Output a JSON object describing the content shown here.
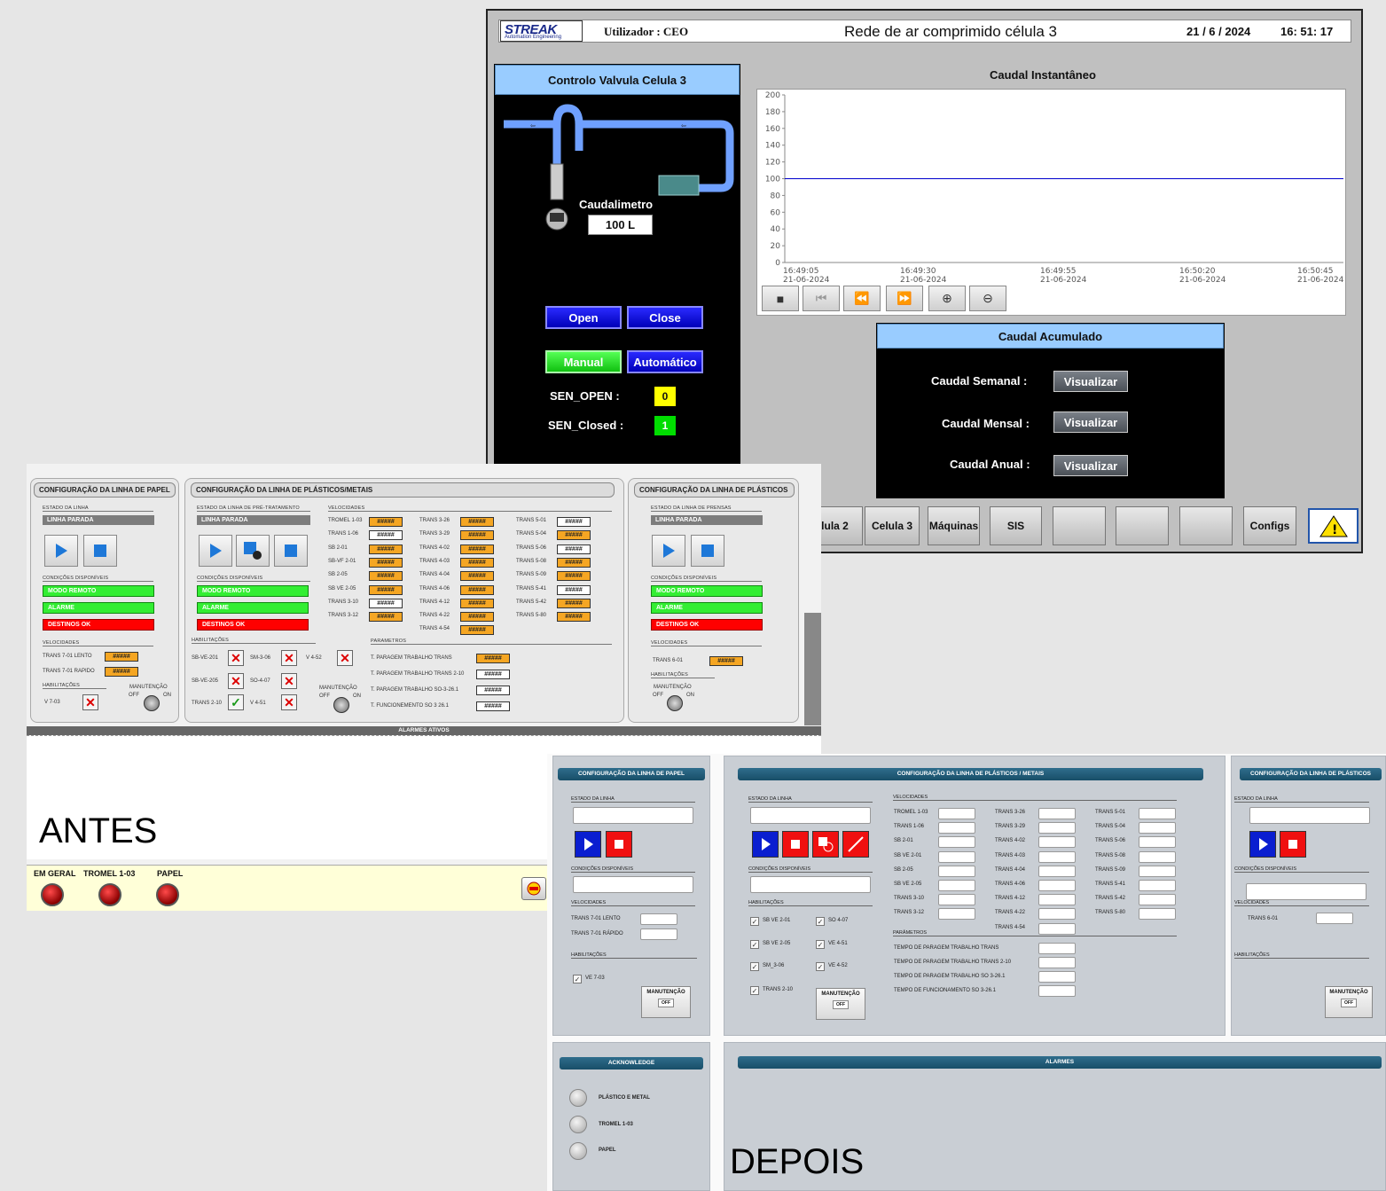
{
  "scada": {
    "logo_brand": "STREAK",
    "logo_sub": "Automation Engineering",
    "user_label": "Utilizador : CEO",
    "title": "Rede de ar comprimido célula 3",
    "date": "21 / 6 / 2024",
    "time": "16: 51: 17",
    "valve_panel_title": "Controlo Valvula Celula 3",
    "flowmeter_label": "Caudalimetro",
    "flowmeter_value": "100 L",
    "open_label": "Open",
    "close_label": "Close",
    "manual_label": "Manual",
    "auto_label": "Automático",
    "sen_open_label": "SEN_OPEN :",
    "sen_open_value": "0",
    "sen_closed_label": "SEN_Closed :",
    "sen_closed_value": "1",
    "chart_title": "Caudal Instantâneo",
    "accum_title": "Caudal Acumulado",
    "weekly_label": "Caudal Semanal :",
    "monthly_label": "Caudal Mensal :",
    "annual_label": "Caudal Anual :",
    "view_label": "Visualizar",
    "nav": [
      "lula 2",
      "Celula 3",
      "Máquinas",
      "SIS",
      "",
      "",
      "",
      "Configs"
    ],
    "colors": {
      "accent_blue": "#0000cc",
      "sen_open": "#ffff00",
      "sen_closed": "#00dd00",
      "panel_title_bg": "#99ccff"
    }
  },
  "chart_data": {
    "type": "line",
    "title": "Caudal Instantâneo",
    "x": [
      "16:49:05",
      "16:49:30",
      "16:49:55",
      "16:50:20",
      "16:50:45"
    ],
    "x_dates": [
      "21-06-2024",
      "21-06-2024",
      "21-06-2024",
      "21-06-2024",
      "21-06-2024"
    ],
    "series": [
      {
        "values": [
          100,
          100,
          100,
          100,
          100
        ]
      }
    ],
    "ylim": [
      0,
      200
    ],
    "yticks": [
      "200",
      "180",
      "160",
      "140",
      "120",
      "100",
      "80",
      "60",
      "40",
      "20",
      "0"
    ],
    "grid": false
  },
  "antes": {
    "label": "ANTES",
    "papel": {
      "title": "CONFIGURAÇÃO DA LINHA DE PAPEL",
      "estado": "ESTADO DA LINHA",
      "linha": "LINHA PARADA",
      "cond": "CONDIÇÕES DISPONÍVEIS",
      "modo": "MODO REMOTO",
      "alarme": "ALARME",
      "destinos": "DESTINOS OK",
      "vel": "VELOCIDADES",
      "v1": "TRANS 7-01 LENTO",
      "v2": "TRANS 7-01 RAPIDO",
      "hab": "HABILITAÇÕES",
      "h1": "V 7-03",
      "mant": "MANUTENÇÃO",
      "off": "OFF",
      "on": "ON",
      "hash": "#####"
    },
    "plast": {
      "title": "CONFIGURAÇÃO DA LINHA DE PLÁSTICOS/METAIS",
      "estado": "ESTADO DA LINHA DE PRÉ-TRATAMENTO",
      "linha": "LINHA PARADA",
      "cond": "CONDIÇÕES DISPONÍVEIS",
      "modo": "MODO REMOTO",
      "alarme": "ALARME",
      "destinos": "DESTINOS OK",
      "vel": "VELOCIDADES",
      "col1": [
        "TROMEL 1-03",
        "TRANS 1-06",
        "SB 2-01",
        "SB-VF 2-01",
        "SB 2-05",
        "SB VE 2-05",
        "TRANS 3-10",
        "TRANS 3-12"
      ],
      "col2": [
        "TRANS 3-26",
        "TRANS 3-29",
        "TRANS 4-02",
        "TRANS 4-03",
        "TRANS 4-04",
        "TRANS 4-06",
        "TRANS 4-12",
        "TRANS 4-22",
        "TRANS 4-54"
      ],
      "col3": [
        "TRANS 5-01",
        "TRANS 5-04",
        "TRANS 5-06",
        "TRANS 5-08",
        "TRANS 5-09",
        "TRANS 5-41",
        "TRANS 5-42",
        "TRANS 5-80"
      ],
      "hab": "HABILITAÇÕES",
      "h": [
        "SB-VE-201",
        "SM-3-06",
        "V 4-52",
        "SB-VE-205",
        "SO-4-07",
        "TRANS 2-10",
        "V 4-51"
      ],
      "mant": "MANUTENÇÃO",
      "off": "OFF",
      "on": "ON",
      "param": "PARAMETROS",
      "p": [
        "T. PARAGEM TRABALHO TRANS",
        "T. PARAGEM TRABALHO TRANS 2-10",
        "T. PARAGEM TRABALHO SO-3-26.1",
        "T. FUNCIONEMENTO SO 3 26.1"
      ],
      "hash": "#####"
    },
    "plastico": {
      "title": "CONFIGURAÇÃO DA LINHA DE PLÁSTICOS",
      "estado": "ESTADO DA LINHA DE PRENSAS",
      "linha": "LINHA PARADA",
      "cond": "CONDIÇÕES DISPONÍVEIS",
      "modo": "MODO REMOTO",
      "alarme": "ALARME",
      "destinos": "DESTINOS OK",
      "vel": "VELOCIDADES",
      "v1": "TRANS 6-01",
      "hab": "HABILITAÇÕES",
      "mant": "MANUTENÇÃO",
      "off": "OFF",
      "on": "ON",
      "hash": "#####"
    },
    "alarms_title": "ALARMES ATIVOS",
    "leds": [
      "EM GERAL",
      "TROMEL 1-03",
      "PAPEL"
    ]
  },
  "depois": {
    "label": "DEPOIS",
    "papel": {
      "title": "CONFIGURAÇÃO DA LINHA DE PAPEL",
      "estado": "ESTADO DA LINHA",
      "cond": "CONDIÇÕES DISPONÍVEIS",
      "vel": "VELOCIDADES",
      "v1": "TRANS 7-01 LENTO",
      "v2": "TRANS 7-01 RÁPIDO",
      "hab": "HABILITAÇÕES",
      "h1": "VE 7-03",
      "mant": "MANUTENÇÃO",
      "off": "OFF"
    },
    "plast": {
      "title": "CONFIGURAÇÃO DA LINHA DE PLÁSTICOS / METAIS",
      "estado": "ESTADO DA LINHA",
      "cond": "CONDIÇÕES DISPONÍVEIS",
      "vel": "VELOCIDADES",
      "col1": [
        "TROMEL 1-03",
        "TRANS 1-06",
        "SB 2-01",
        "SB VE 2-01",
        "SB 2-05",
        "SB VE 2-05",
        "TRANS 3-10",
        "TRANS 3-12"
      ],
      "col2": [
        "TRANS 3-26",
        "TRANS 3-29",
        "TRANS 4-02",
        "TRANS 4-03",
        "TRANS 4-04",
        "TRANS 4-06",
        "TRANS 4-12",
        "TRANS 4-22",
        "TRANS 4-54"
      ],
      "col3": [
        "TRANS 5-01",
        "TRANS 5-04",
        "TRANS 5-06",
        "TRANS 5-08",
        "TRANS 5-09",
        "TRANS 5-41",
        "TRANS 5-42",
        "TRANS 5-80"
      ],
      "hab": "HABILITAÇÕES",
      "h": [
        "SB VE 2-01",
        "SO 4-07",
        "SB VE 2-05",
        "VE 4-51",
        "SM_3-06",
        "VE 4-52",
        "TRANS 2-10"
      ],
      "mant": "MANUTENÇÃO",
      "off": "OFF",
      "param": "PARÂMETROS",
      "p": [
        "TEMPO DE PARAGEM TRABALHO TRANS",
        "TEMPO DE PARAGEM TRABALHO TRANS 2-10",
        "TEMPO DE PARAGEM TRABALHO SO 3-26.1",
        "TEMPO DE FUNCIONAMENTO SO 3-26.1"
      ]
    },
    "plastico": {
      "title": "CONFIGURAÇÃO DA LINHA DE PLÁSTICOS",
      "estado": "ESTADO DA LINHA",
      "cond": "CONDIÇÕES DISPONÍVEIS",
      "vel": "VELOCIDADES",
      "v1": "TRANS 6-01",
      "hab": "HABILITAÇÕES",
      "mant": "MANUTENÇÃO",
      "off": "OFF"
    },
    "ack_title": "ACKNOWLEDGE",
    "ack": [
      "PLÁSTICO E METAL",
      "TROMEL 1-03",
      "PAPEL"
    ],
    "alarms_title": "ALARMES"
  }
}
